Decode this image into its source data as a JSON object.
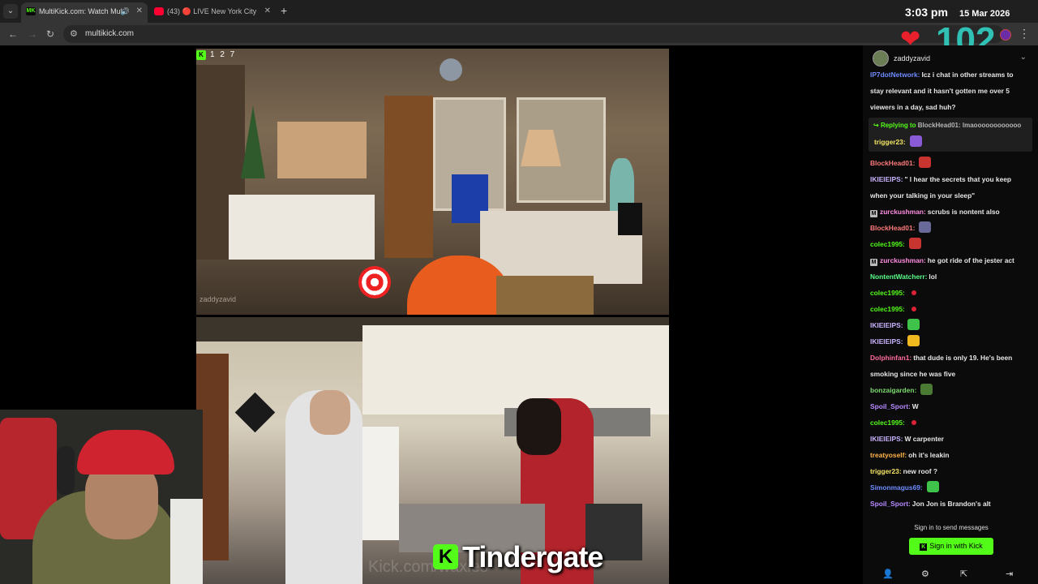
{
  "browser": {
    "tabs": [
      {
        "label": "MultiKick.com: Watch Multi",
        "active": true,
        "favicon": "MK"
      },
      {
        "label": "(43) 🔴 LIVE New York City",
        "active": false
      }
    ],
    "url": "multikick.com"
  },
  "overlay": {
    "time": "3:03 pm",
    "date": "15 Mar 2026",
    "viewer_count": "102",
    "brand_text": "Tindergate",
    "ghost_url": "Kick.com/waxies",
    "cam1_slots": "1 2 7",
    "cam1_watermark": "zaddyzavid"
  },
  "chat": {
    "channel": "zaddyzavid",
    "reply_prefix": "Replying to",
    "reply_target": "BlockHead01:",
    "reply_text": "lmaoooooooooooo",
    "reply_user": "trigger23:",
    "messages": [
      {
        "user": "IP7dotNetwork:",
        "color": "#6e8bff",
        "text": "Icz i chat in other streams to"
      },
      {
        "user": "",
        "color": "#e6e6e6",
        "text": "stay relevant and it hasn't gotten me over 5"
      },
      {
        "user": "",
        "color": "#e6e6e6",
        "text": "viewers in a day, sad huh?"
      },
      {
        "user": "BlockHead01:",
        "color": "#ff7a7a",
        "text": ""
      },
      {
        "user": "IKIEIEIPS:",
        "color": "#c9b3ff",
        "text": "\" I hear the secrets that you keep"
      },
      {
        "user": "",
        "color": "#e6e6e6",
        "text": "when your talking in your sleep\""
      },
      {
        "user": "zurckushman:",
        "color": "#ff8de1",
        "text": "scrubs is nontent also"
      },
      {
        "user": "BlockHead01:",
        "color": "#ff7a7a",
        "text": ""
      },
      {
        "user": "colec1995:",
        "color": "#53fc18",
        "text": ""
      },
      {
        "user": "zurckushman:",
        "color": "#ff8de1",
        "text": "he got ride of the jester act"
      },
      {
        "user": "NontentWatcherr:",
        "color": "#5cff8b",
        "text": "lol"
      },
      {
        "user": "colec1995:",
        "color": "#53fc18",
        "text": ""
      },
      {
        "user": "colec1995:",
        "color": "#53fc18",
        "text": ""
      },
      {
        "user": "IKIEIEIPS:",
        "color": "#c9b3ff",
        "text": ""
      },
      {
        "user": "IKIEIEIPS:",
        "color": "#c9b3ff",
        "text": ""
      },
      {
        "user": "Dolphinfan1:",
        "color": "#ff6b9d",
        "text": "that dude is only 19. He's been"
      },
      {
        "user": "",
        "color": "#e6e6e6",
        "text": "smoking since he was five"
      },
      {
        "user": "bonzaigarden:",
        "color": "#7ddc6f",
        "text": ""
      },
      {
        "user": "Spoil_Sport:",
        "color": "#b58aff",
        "text": "W"
      },
      {
        "user": "colec1995:",
        "color": "#53fc18",
        "text": ""
      },
      {
        "user": "IKIEIEIPS:",
        "color": "#c9b3ff",
        "text": "W carpenter"
      },
      {
        "user": "treatyoself:",
        "color": "#ffb347",
        "text": "oh it's leakin"
      },
      {
        "user": "trigger23:",
        "color": "#f5e663",
        "text": "new roof ?"
      },
      {
        "user": "Simonmagus69:",
        "color": "#6e8bff",
        "text": ""
      },
      {
        "user": "Spoil_Sport:",
        "color": "#b58aff",
        "text": "Jon Jon is Brandon's alt"
      }
    ],
    "signin_prompt": "Sign in to send messages",
    "signin_button": "Sign in with Kick"
  },
  "colors": {
    "kick_green": "#53fc18",
    "viewer_teal": "#31c0b4",
    "heart_red": "#e8202b"
  }
}
